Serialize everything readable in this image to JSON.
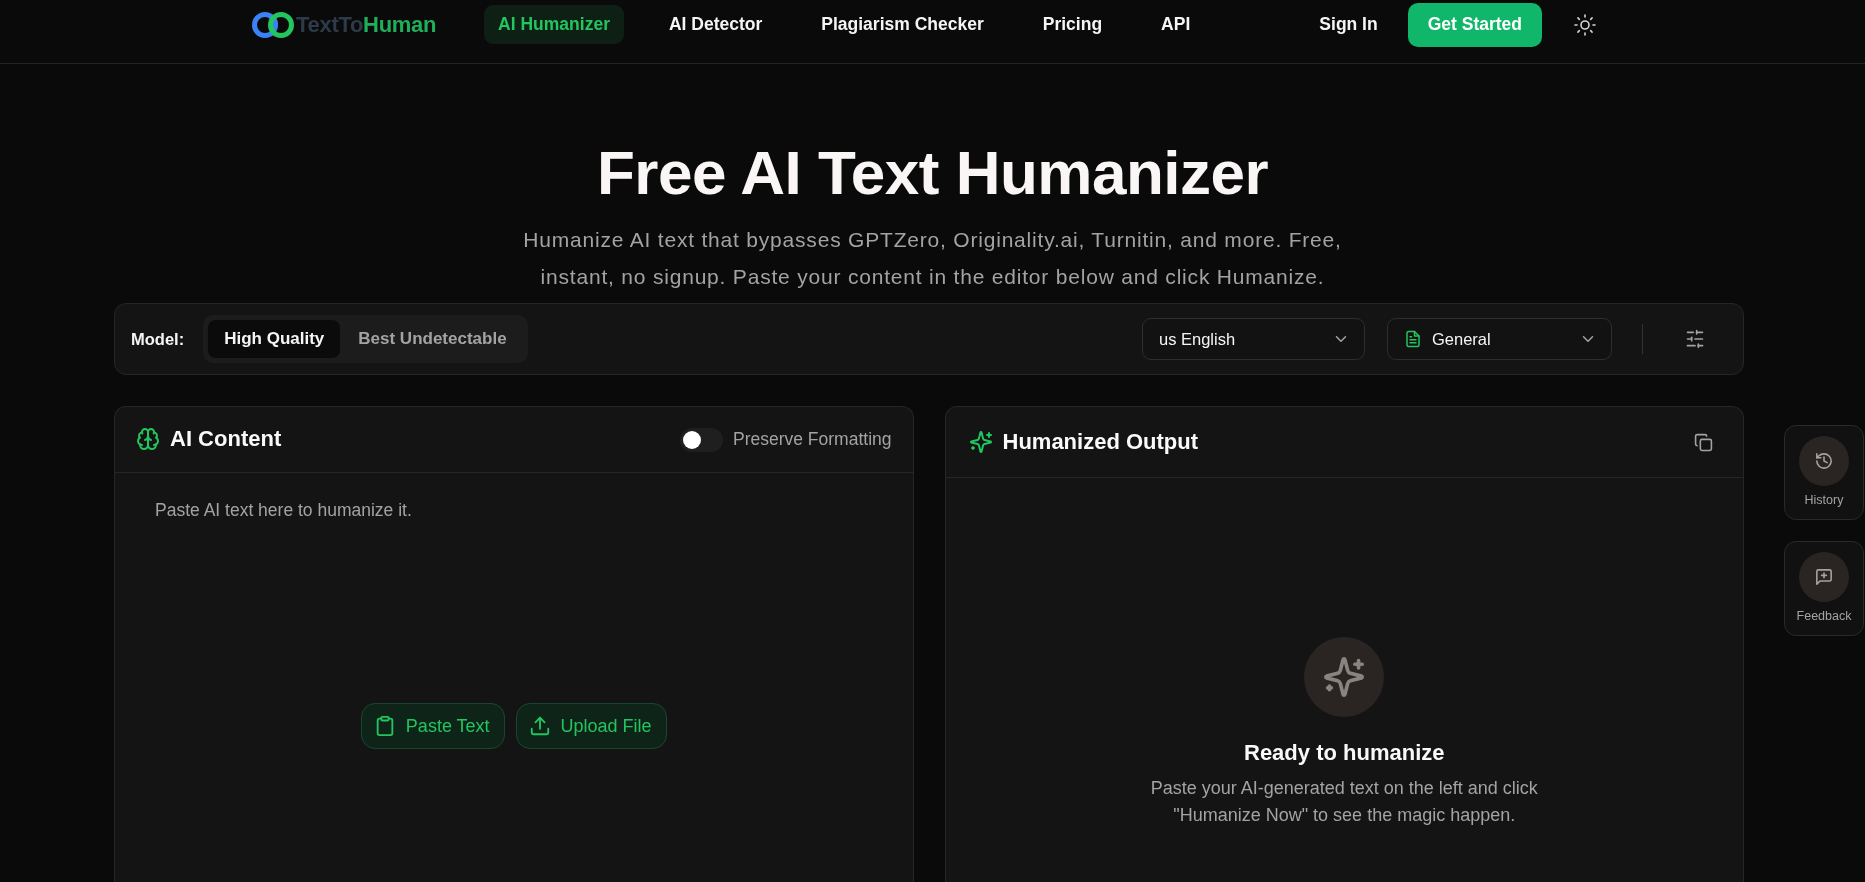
{
  "header": {
    "logo": {
      "prefix": "TextTo",
      "suffix": "Human"
    },
    "nav": [
      {
        "label": "AI Humanizer",
        "selected": true
      },
      {
        "label": "AI Detector",
        "selected": false
      },
      {
        "label": "Plagiarism Checker",
        "selected": false
      },
      {
        "label": "Pricing",
        "selected": false
      },
      {
        "label": "API",
        "selected": false
      }
    ],
    "sign_in": "Sign In",
    "get_started": "Get Started"
  },
  "hero": {
    "title": "Free AI Text Humanizer",
    "subtitle": "Humanize AI text that bypasses GPTZero, Originality.ai, Turnitin, and more. Free, instant, no signup. Paste your content in the editor below and click Humanize."
  },
  "toolbar": {
    "model_label": "Model:",
    "models": [
      {
        "label": "High Quality",
        "selected": true
      },
      {
        "label": "Best Undetectable",
        "selected": false
      }
    ],
    "language": "us English",
    "mode": "General"
  },
  "input_panel": {
    "title": "AI Content",
    "preserve_formatting": {
      "label": "Preserve Formatting",
      "on": false
    },
    "placeholder": "Paste AI text here to humanize it.",
    "actions": [
      {
        "kind": "paste",
        "label": "Paste Text"
      },
      {
        "kind": "upload",
        "label": "Upload File"
      }
    ]
  },
  "output_panel": {
    "title": "Humanized Output",
    "empty_title": "Ready to humanize",
    "empty_text": "Paste your AI-generated text on the left and click \"Humanize Now\" to see the magic happen."
  },
  "side_buttons": [
    {
      "kind": "history",
      "label": "History"
    },
    {
      "kind": "feedback",
      "label": "Feedback"
    }
  ]
}
